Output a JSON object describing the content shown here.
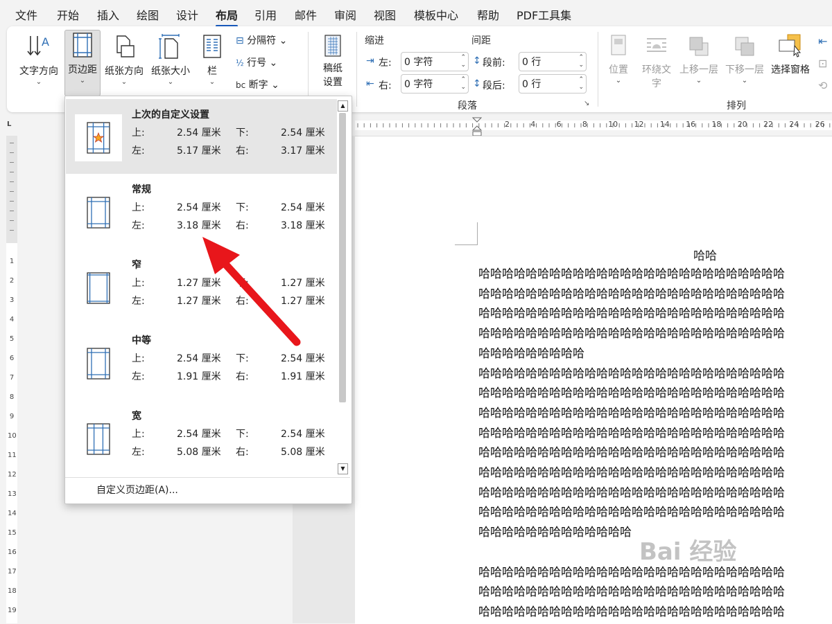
{
  "menu_tabs": [
    "文件",
    "开始",
    "插入",
    "绘图",
    "设计",
    "布局",
    "引用",
    "邮件",
    "审阅",
    "视图",
    "模板中心",
    "帮助",
    "PDF工具集"
  ],
  "active_tab": "布局",
  "ribbon": {
    "text_direction": "文字方向",
    "margins": "页边距",
    "orientation": "纸张方向",
    "size": "纸张大小",
    "columns": "栏",
    "breaks": "分隔符",
    "line_numbers": "行号",
    "hyphenation": "断字",
    "draft_paper_1": "稿纸",
    "draft_paper_2": "设置",
    "indent_header": "缩进",
    "spacing_header": "间距",
    "indent_left_label": "左:",
    "indent_left_value": "0 字符",
    "indent_right_label": "右:",
    "indent_right_value": "0 字符",
    "spacing_before_label": "段前:",
    "spacing_before_value": "0 行",
    "spacing_after_label": "段后:",
    "spacing_after_value": "0 行",
    "paragraph_group": "段落",
    "position": "位置",
    "wrap_text_1": "环绕文",
    "wrap_text_2": "字",
    "bring_forward": "上移一层",
    "send_backward": "下移一层",
    "selection_pane": "选择窗格",
    "arrange_group": "排列"
  },
  "ruler_numbers": [
    "2",
    "4",
    "6",
    "8",
    "10",
    "12",
    "14",
    "16",
    "18",
    "20",
    "22",
    "24",
    "26"
  ],
  "vruler_numbers": [
    "1",
    "2",
    "3",
    "4",
    "5",
    "6",
    "7",
    "8",
    "9",
    "10",
    "11",
    "12",
    "13",
    "14",
    "15",
    "16",
    "17",
    "18",
    "19"
  ],
  "dropdown": {
    "items": [
      {
        "title": "上次的自定义设置",
        "top_label": "上:",
        "top": "2.54 厘米",
        "bottom_label": "下:",
        "bottom": "2.54 厘米",
        "left_label": "左:",
        "left": "5.17 厘米",
        "right_label": "右:",
        "right": "3.17 厘米"
      },
      {
        "title": "常规",
        "top_label": "上:",
        "top": "2.54 厘米",
        "bottom_label": "下:",
        "bottom": "2.54 厘米",
        "left_label": "左:",
        "left": "3.18 厘米",
        "right_label": "右:",
        "right": "3.18 厘米"
      },
      {
        "title": "窄",
        "top_label": "上:",
        "top": "1.27 厘米",
        "bottom_label": "下:",
        "bottom": "1.27 厘米",
        "left_label": "左:",
        "left": "1.27 厘米",
        "right_label": "右:",
        "right": "1.27 厘米"
      },
      {
        "title": "中等",
        "top_label": "上:",
        "top": "2.54 厘米",
        "bottom_label": "下:",
        "bottom": "2.54 厘米",
        "left_label": "左:",
        "left": "1.91 厘米",
        "right_label": "右:",
        "right": "1.91 厘米"
      },
      {
        "title": "宽",
        "top_label": "上:",
        "top": "2.54 厘米",
        "bottom_label": "下:",
        "bottom": "2.54 厘米",
        "left_label": "左:",
        "left": "5.08 厘米",
        "right_label": "右:",
        "right": "5.08 厘米"
      }
    ],
    "custom": "自定义页边距(A)..."
  },
  "document": {
    "title": "哈哈",
    "lines": [
      "哈哈哈哈哈哈哈哈哈哈哈哈哈哈哈哈哈哈哈哈哈哈哈哈哈哈",
      "哈哈哈哈哈哈哈哈哈哈哈哈哈哈哈哈哈哈哈哈哈哈哈哈哈哈",
      "哈哈哈哈哈哈哈哈哈哈哈哈哈哈哈哈哈哈哈哈哈哈哈哈哈哈",
      "哈哈哈哈哈哈哈哈哈哈哈哈哈哈哈哈哈哈哈哈哈哈哈哈哈哈",
      "哈哈哈哈哈哈哈哈哈",
      "哈哈哈哈哈哈哈哈哈哈哈哈哈哈哈哈哈哈哈哈哈哈哈哈哈哈",
      "哈哈哈哈哈哈哈哈哈哈哈哈哈哈哈哈哈哈哈哈哈哈哈哈哈哈",
      "哈哈哈哈哈哈哈哈哈哈哈哈哈哈哈哈哈哈哈哈哈哈哈哈哈哈",
      "哈哈哈哈哈哈哈哈哈哈哈哈哈哈哈哈哈哈哈哈哈哈哈哈哈哈",
      "哈哈哈哈哈哈哈哈哈哈哈哈哈哈哈哈哈哈哈哈哈哈哈哈哈哈",
      "哈哈哈哈哈哈哈哈哈哈哈哈哈哈哈哈哈哈哈哈哈哈哈哈哈哈",
      "哈哈哈哈哈哈哈哈哈哈哈哈哈哈哈哈哈哈哈哈哈哈哈哈哈哈",
      "哈哈哈哈哈哈哈哈哈哈哈哈哈哈哈哈哈哈哈哈哈哈哈哈哈哈",
      "哈哈哈哈哈哈哈哈哈哈哈哈哈",
      "",
      "哈哈哈哈哈哈哈哈哈哈哈哈哈哈哈哈哈哈哈哈哈哈哈哈哈哈",
      "哈哈哈哈哈哈哈哈哈哈哈哈哈哈哈哈哈哈哈哈哈哈哈哈哈哈",
      "哈哈哈哈哈哈哈哈哈哈哈哈哈哈哈哈哈哈哈哈哈哈哈哈哈哈"
    ]
  },
  "watermark": "Bai 经验",
  "colors": {
    "accent": "#185abd",
    "arrow": "#e8161b",
    "icon_blue": "#2f6fb5"
  }
}
